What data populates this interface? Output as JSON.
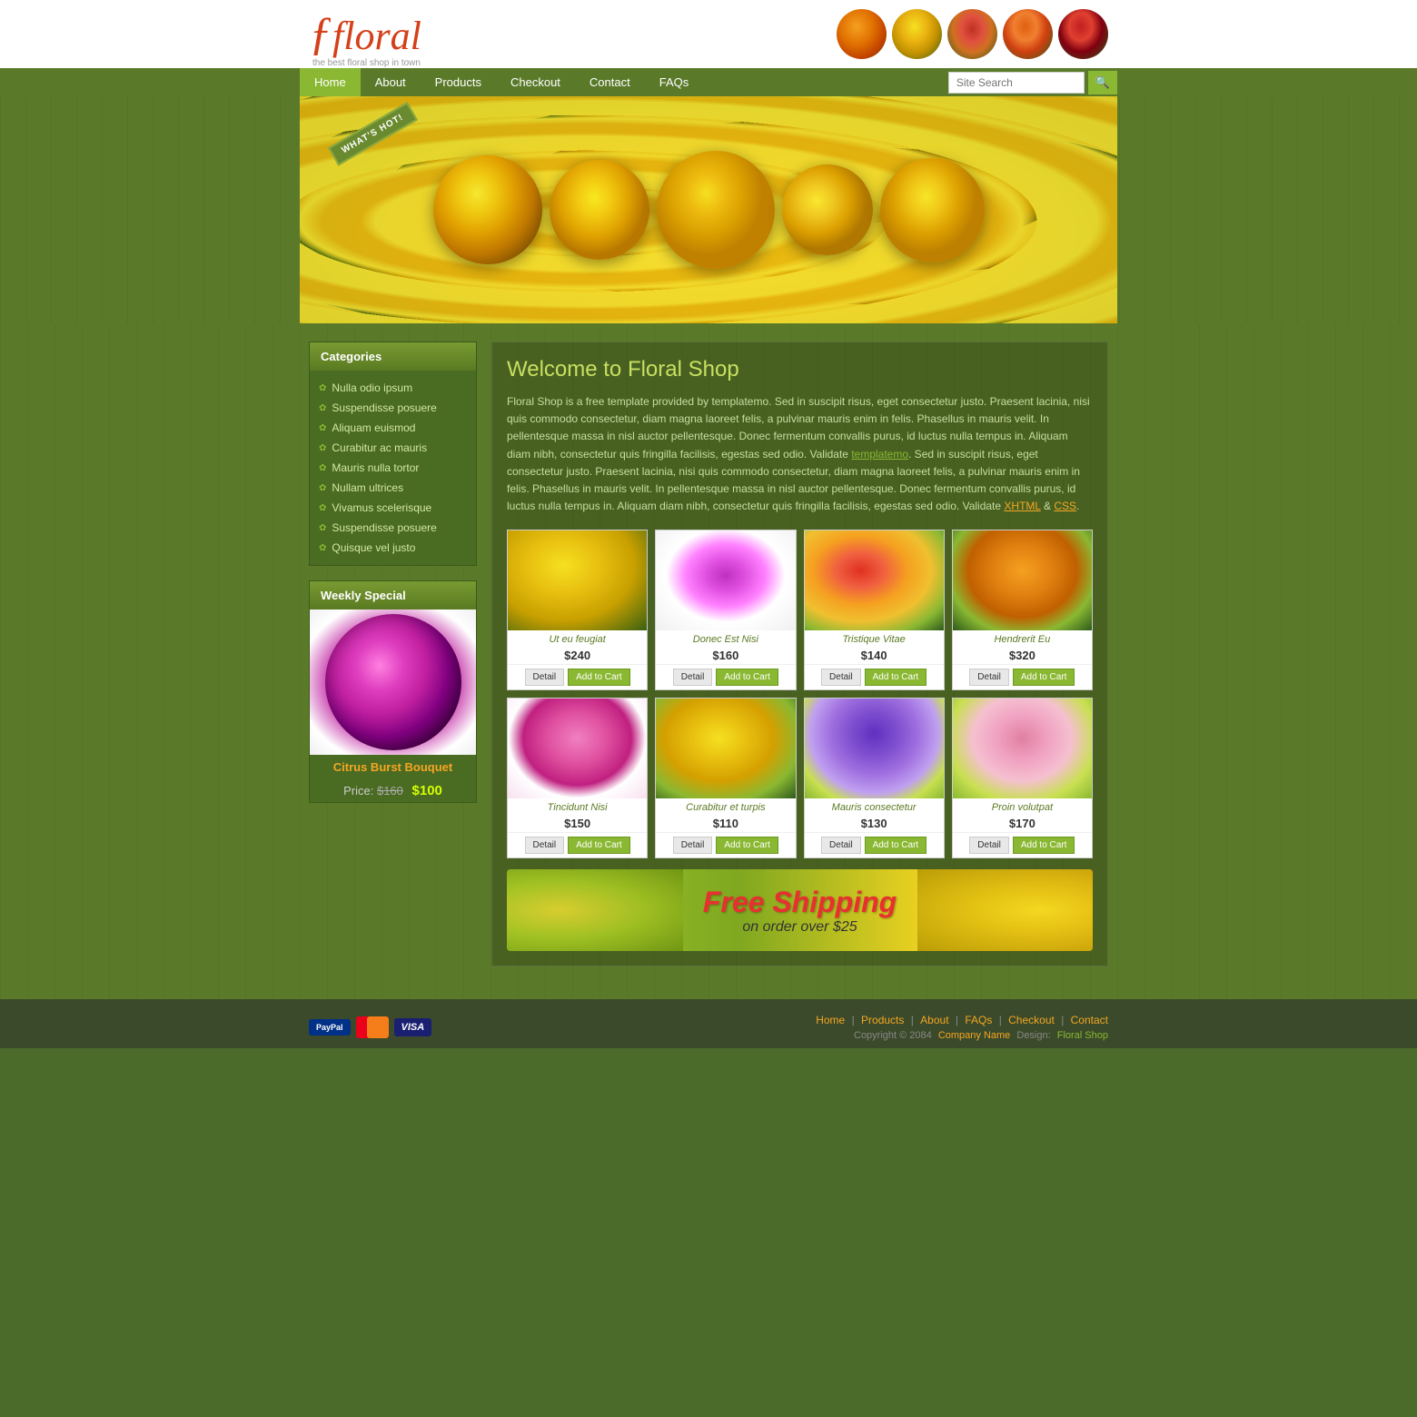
{
  "site": {
    "logo": {
      "brand": "floral",
      "tagline": "the best floral shop in town"
    }
  },
  "nav": {
    "items": [
      {
        "label": "Home",
        "active": true
      },
      {
        "label": "About",
        "active": false
      },
      {
        "label": "Products",
        "active": false
      },
      {
        "label": "Checkout",
        "active": false
      },
      {
        "label": "Contact",
        "active": false
      },
      {
        "label": "FAQs",
        "active": false
      }
    ],
    "search": {
      "placeholder": "Site Search"
    }
  },
  "banner": {
    "whats_hot": "WHAT'S HOT!"
  },
  "sidebar": {
    "categories": {
      "title": "Categories",
      "items": [
        {
          "label": "Nulla odio ipsum"
        },
        {
          "label": "Suspendisse posuere"
        },
        {
          "label": "Aliquam euismod"
        },
        {
          "label": "Curabitur ac mauris"
        },
        {
          "label": "Mauris nulla tortor"
        },
        {
          "label": "Nullam ultrices"
        },
        {
          "label": "Vivamus scelerisque"
        },
        {
          "label": "Suspendisse posuere"
        },
        {
          "label": "Quisque vel justo"
        }
      ]
    },
    "weekly_special": {
      "title": "Weekly Special",
      "product_name": "Citrus Burst Bouquet",
      "price_label": "Price:",
      "old_price": "$160",
      "new_price": "$100"
    }
  },
  "content": {
    "welcome_title": "Welcome to Floral Shop",
    "welcome_text": "Floral Shop is a free template provided by templatemo. Sed in suscipit risus, eget consectetur justo. Praesent lacinia, nisi quis commodo consectetur, diam magna laoreet felis, a pulvinar mauris enim in felis. Phasellus in mauris velit. In pellentesque massa in nisl auctor pellentesque. Donec fermentum convallis purus, id luctus nulla tempus in. Aliquam diam nibh, consectetur quis fringilla facilisis, egestas sed odio. Validate ",
    "validate_xhtml": "XHTML",
    "validate_css": "CSS",
    "templatemo_link": "templatemo",
    "products": [
      {
        "name": "Ut eu feugiat",
        "price": "$240",
        "color": "rose-yellow",
        "row": 1
      },
      {
        "name": "Donec Est Nisi",
        "price": "$160",
        "color": "gerbera-pink",
        "row": 1
      },
      {
        "name": "Tristique Vitae",
        "price": "$140",
        "color": "mixed-flowers",
        "row": 1
      },
      {
        "name": "Hendrerit Eu",
        "price": "$320",
        "color": "orange-flowers",
        "row": 1
      },
      {
        "name": "Tincidunt Nisi",
        "price": "$150",
        "color": "pink-flower",
        "row": 2
      },
      {
        "name": "Curabitur et turpis",
        "price": "$110",
        "color": "yellow-roses",
        "row": 2
      },
      {
        "name": "Mauris consectetur",
        "price": "$130",
        "color": "purple-tulips",
        "row": 2
      },
      {
        "name": "Proin volutpat",
        "price": "$170",
        "color": "pink-tulips",
        "row": 2
      }
    ],
    "buttons": {
      "detail": "Detail",
      "add_to_cart": "Add to Cart"
    }
  },
  "shipping": {
    "main": "Free Shipping",
    "sub": "on order over $25"
  },
  "footer": {
    "nav_links": [
      "Home",
      "Products",
      "About",
      "FAQs",
      "Checkout",
      "Contact"
    ],
    "copyright": "Copyright © 2084",
    "company": "Company Name",
    "design_label": "Design:",
    "design_credit": "Floral Shop"
  }
}
